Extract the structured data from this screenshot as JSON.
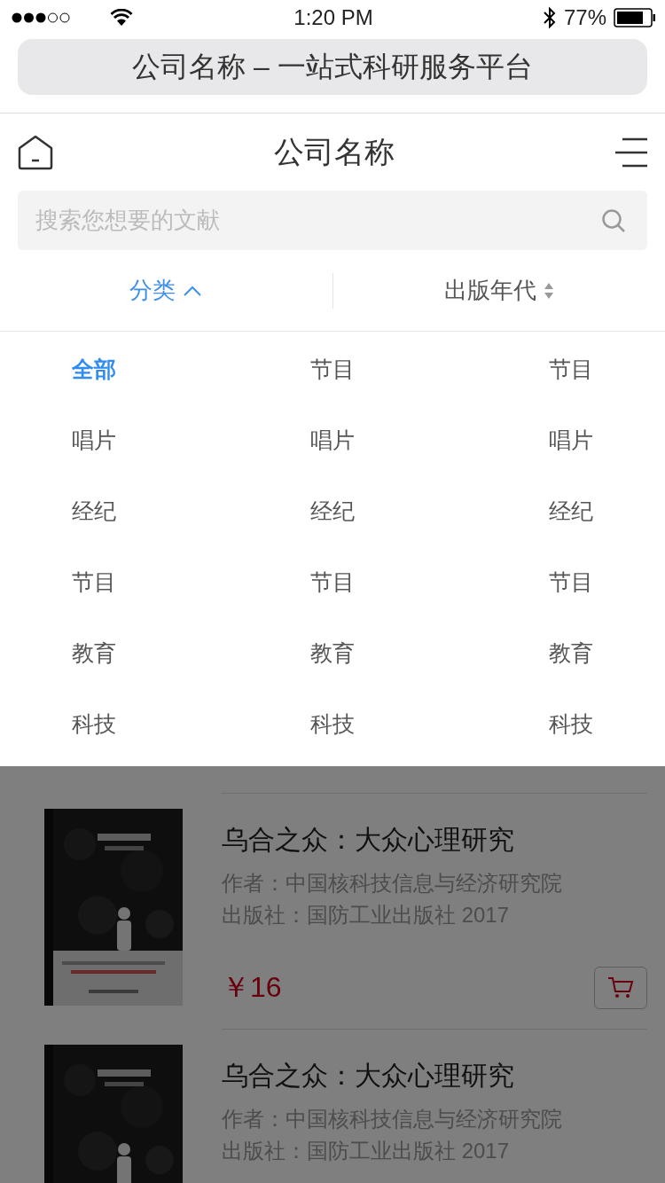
{
  "status_bar": {
    "time": "1:20 PM",
    "battery": "77%"
  },
  "url_bar": {
    "title": "公司名称 – 一站式科研服务平台"
  },
  "header": {
    "title": "公司名称"
  },
  "search": {
    "placeholder": "搜索您想要的文献"
  },
  "filters": [
    {
      "label": "分类",
      "kind": "dropdown",
      "selected": true,
      "expanded": true
    },
    {
      "label": "出版年代",
      "kind": "sort",
      "selected": false
    }
  ],
  "categories": [
    {
      "label": "全部",
      "selected": true
    },
    {
      "label": "节目",
      "selected": false
    },
    {
      "label": "节目",
      "selected": false
    },
    {
      "label": "唱片",
      "selected": false
    },
    {
      "label": "唱片",
      "selected": false
    },
    {
      "label": "唱片",
      "selected": false
    },
    {
      "label": "经纪",
      "selected": false
    },
    {
      "label": "经纪",
      "selected": false
    },
    {
      "label": "经纪",
      "selected": false
    },
    {
      "label": "节目",
      "selected": false
    },
    {
      "label": "节目",
      "selected": false
    },
    {
      "label": "节目",
      "selected": false
    },
    {
      "label": "教育",
      "selected": false
    },
    {
      "label": "教育",
      "selected": false
    },
    {
      "label": "教育",
      "selected": false
    },
    {
      "label": "科技",
      "selected": false
    },
    {
      "label": "科技",
      "selected": false
    },
    {
      "label": "科技",
      "selected": false
    }
  ],
  "books": [
    {
      "title": "乌合之众：大众心理研究",
      "author": "作者：中国核科技信息与经济研究院",
      "publisher": "出版社：国防工业出版社 2017",
      "price": "￥16"
    },
    {
      "title": "乌合之众：大众心理研究",
      "author": "作者：中国核科技信息与经济研究院",
      "publisher": "出版社：国防工业出版社 2017"
    }
  ]
}
